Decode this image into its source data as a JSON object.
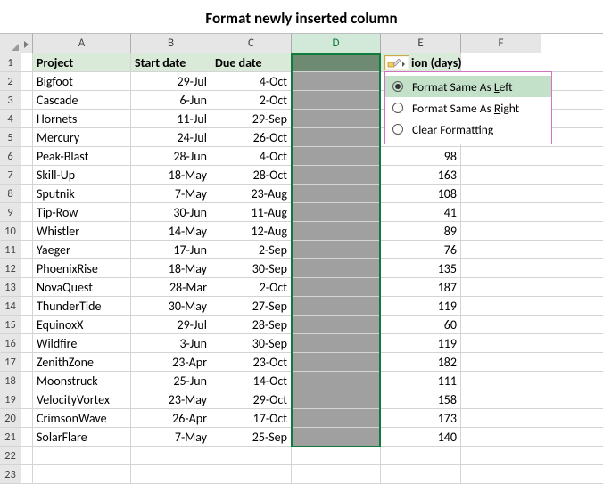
{
  "title": "Format newly inserted column",
  "columns": [
    "A",
    "B",
    "C",
    "D",
    "E",
    "F"
  ],
  "headers": {
    "A": "Project",
    "B": "Start date",
    "C": "Due date",
    "D": "",
    "E_visible": "ion (days)"
  },
  "rows": [
    {
      "n": "2",
      "A": "Bigfoot",
      "B": "29-Jul",
      "C": "4-Oct",
      "E": ""
    },
    {
      "n": "3",
      "A": "Cascade",
      "B": "6-Jun",
      "C": "2-Oct",
      "E": ""
    },
    {
      "n": "4",
      "A": "Hornets",
      "B": "11-Jul",
      "C": "29-Sep",
      "E": ""
    },
    {
      "n": "5",
      "A": "Mercury",
      "B": "24-Jul",
      "C": "26-Oct",
      "E": ""
    },
    {
      "n": "6",
      "A": "Peak-Blast",
      "B": "28-Jun",
      "C": "4-Oct",
      "E": "98"
    },
    {
      "n": "7",
      "A": "Skill-Up",
      "B": "18-May",
      "C": "28-Oct",
      "E": "163"
    },
    {
      "n": "8",
      "A": "Sputnik",
      "B": "7-May",
      "C": "23-Aug",
      "E": "108"
    },
    {
      "n": "9",
      "A": "Tip-Row",
      "B": "30-Jun",
      "C": "11-Aug",
      "E": "41"
    },
    {
      "n": "10",
      "A": "Whistler",
      "B": "14-May",
      "C": "12-Aug",
      "E": "89"
    },
    {
      "n": "11",
      "A": "Yaeger",
      "B": "17-Jun",
      "C": "2-Sep",
      "E": "76"
    },
    {
      "n": "12",
      "A": "PhoenixRise",
      "B": "18-May",
      "C": "30-Sep",
      "E": "135"
    },
    {
      "n": "13",
      "A": "NovaQuest",
      "B": "28-Mar",
      "C": "2-Oct",
      "E": "187"
    },
    {
      "n": "14",
      "A": "ThunderTide",
      "B": "30-May",
      "C": "27-Sep",
      "E": "119"
    },
    {
      "n": "15",
      "A": "EquinoxX",
      "B": "29-Jul",
      "C": "28-Sep",
      "E": "60"
    },
    {
      "n": "16",
      "A": "Wildfire",
      "B": "3-Jun",
      "C": "30-Sep",
      "E": "119"
    },
    {
      "n": "17",
      "A": "ZenithZone",
      "B": "23-Apr",
      "C": "23-Oct",
      "E": "182"
    },
    {
      "n": "18",
      "A": "Moonstruck",
      "B": "25-Jun",
      "C": "14-Oct",
      "E": "111"
    },
    {
      "n": "19",
      "A": "VelocityVortex",
      "B": "23-May",
      "C": "29-Oct",
      "E": "158"
    },
    {
      "n": "20",
      "A": "CrimsonWave",
      "B": "26-Apr",
      "C": "17-Oct",
      "E": "173"
    },
    {
      "n": "21",
      "A": "SolarFlare",
      "B": "7-May",
      "C": "25-Sep",
      "E": "140"
    }
  ],
  "empty_rows": [
    "22",
    "23"
  ],
  "row1": "1",
  "popup": {
    "opt1": "Format Same As ",
    "opt1u": "L",
    "opt1b": "eft",
    "opt2": "Format Same As ",
    "opt2u": "R",
    "opt2b": "ight",
    "opt3u": "C",
    "opt3b": "lear Formatting"
  }
}
